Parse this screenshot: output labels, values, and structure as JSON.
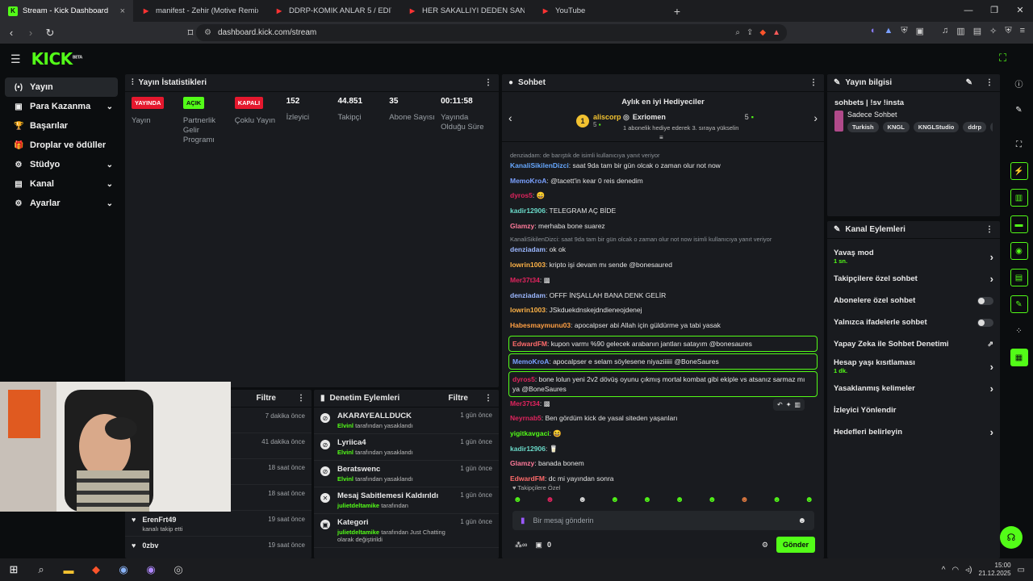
{
  "browser": {
    "tabs": [
      {
        "title": "Stream - Kick Dashboard",
        "icon": "K",
        "color": "#53fc18",
        "active": true
      },
      {
        "title": "manifest - Zehir (Motive Remix) |",
        "icon": "▶",
        "color": "#ff3333"
      },
      {
        "title": "DDRP-KOMIK ANLAR 5 / EDITLI - You",
        "icon": "▶",
        "color": "#ff3333"
      },
      {
        "title": "HER SAKALLIYI DEDEN SANMA | SSri",
        "icon": "▶",
        "color": "#ff3333"
      },
      {
        "title": "YouTube",
        "icon": "▶",
        "color": "#ff3333"
      }
    ],
    "url": "dashboard.kick.com/stream",
    "new_tab": "+"
  },
  "app": {
    "logo": "KICK",
    "logo_sup": "BETA"
  },
  "sidebar": {
    "items": [
      {
        "label": "Yayın",
        "icon": "(•)",
        "active": true
      },
      {
        "label": "Para Kazanma",
        "icon": "▣",
        "chev": "⌄"
      },
      {
        "label": "Başarılar",
        "icon": "🏆"
      },
      {
        "label": "Droplar ve ödüller",
        "icon": "🎁"
      },
      {
        "label": "Stüdyo",
        "icon": "⚙",
        "chev": "⌄"
      },
      {
        "label": "Kanal",
        "icon": "▤",
        "chev": "⌄"
      },
      {
        "label": "Ayarlar",
        "icon": "⚙",
        "chev": "⌄"
      }
    ]
  },
  "stats": {
    "title": "Yayın İstatistikleri",
    "items": [
      {
        "badge": "YAYINDA",
        "badge_bg": "#e5182e",
        "badge_fg": "#fff",
        "label": "Yayın"
      },
      {
        "badge": "AÇIK",
        "badge_bg": "#53fc18",
        "badge_fg": "#0b0d0f",
        "label": "Partnerlik Gelir Programı"
      },
      {
        "badge": "KAPALI",
        "badge_bg": "#e5182e",
        "badge_fg": "#fff",
        "label": "Çoklu Yayın"
      },
      {
        "value": "152",
        "label": "İzleyici"
      },
      {
        "value": "44.851",
        "label": "Takipçi"
      },
      {
        "value": "35",
        "label": "Abone Sayısı"
      },
      {
        "value": "00:11:58",
        "label": "Yayında Olduğu Süre"
      }
    ]
  },
  "history": {
    "filter": "Filtre",
    "rows": [
      {
        "name": "",
        "sub": "",
        "time": "7 dakika önce"
      },
      {
        "name": "",
        "sub": "",
        "time": "41 dakika önce"
      },
      {
        "name": "",
        "sub": "",
        "time": "18 saat önce"
      },
      {
        "name": "",
        "sub": "",
        "time": "18 saat önce"
      },
      {
        "name": "ErenFrt49",
        "sub": "kanalı takip etti",
        "time": "19 saat önce"
      },
      {
        "name": "0zbv",
        "sub": "",
        "time": "19 saat önce"
      }
    ]
  },
  "moderation": {
    "title": "Denetim Eylemleri",
    "filter": "Filtre",
    "rows": [
      {
        "title": "AKARAYEALLDUCK",
        "by": "Elvinl",
        "suffix": " tarafından yasaklandı",
        "time": "1 gün önce",
        "icon": "⊘"
      },
      {
        "title": "Lyriica4",
        "by": "Elvinl",
        "suffix": " tarafından yasaklandı",
        "time": "1 gün önce",
        "icon": "⊘"
      },
      {
        "title": "Beratswenc",
        "by": "Elvinl",
        "suffix": " tarafından yasaklandı",
        "time": "1 gün önce",
        "icon": "⊘"
      },
      {
        "title": "Mesaj Sabitlemesi Kaldırıldı",
        "by": "julietdeltamike",
        "suffix": " tarafından",
        "time": "1 gün önce",
        "icon": "✕"
      },
      {
        "title": "Kategori",
        "by": "julietdeltamike",
        "suffix": " tarafından Just Chatting olarak değiştirildi",
        "time": "1 gün önce",
        "icon": "▣"
      }
    ]
  },
  "chat": {
    "title": "Sohbet",
    "gifters_title": "Aylık en iyi Hediyeciler",
    "gifter1": {
      "rank": "1",
      "name": "aliscorp",
      "count": "5"
    },
    "gifter2": {
      "name": "Exriomen",
      "count": "5"
    },
    "gift_hint": "1 abonelik hediye ederek 3. sıraya yükselin",
    "messages": [
      {
        "reply": "denziadam: de barıştık de isimli kullanıcıya yanıt veriyor"
      },
      {
        "user": "KanaliSikilenDizci",
        "color": "#66a8ff",
        "text": "saat 9da tam bir gün olcak o zaman olur not now"
      },
      {
        "user": "MemoKroA",
        "color": "#7aa0ff",
        "text": "@tacett'in kear 0 reis denedim"
      },
      {
        "user": "dyros5",
        "color": "#e0245e",
        "text": "😄"
      },
      {
        "user": "kadir12906",
        "color": "#6ad9c8",
        "text": "TELEGRAM AÇ BİDE"
      },
      {
        "user": "Glamzy",
        "color": "#ff7a9a",
        "text": "merhaba bone suarez"
      },
      {
        "reply": "KanaliSikilenDizci: saat 9da tam bir gün olcak o zaman olur not now isimli kullanıcıya yanıt veriyor"
      },
      {
        "user": "denziadam",
        "color": "#9bb7ff",
        "text": "ok ok"
      },
      {
        "user": "lowrin1003",
        "color": "#ffb347",
        "text": "kripto işi devam mı sende @bonesaured"
      },
      {
        "user": "Mer37t34",
        "color": "#e0245e",
        "text": "▩"
      },
      {
        "user": "denziadam",
        "color": "#9bb7ff",
        "text": "OFFF İNŞALLAH BANA DENK GELİR"
      },
      {
        "user": "lowrin1003",
        "color": "#ffb347",
        "text": "JSkduekdnskejdndieneojdenej"
      },
      {
        "user": "Habesmaymunu03",
        "color": "#ff9f43",
        "text": "apocalpser abi Allah için güldürme ya tabi yasak"
      },
      {
        "user": "EdwardFM",
        "color": "#ff6b6b",
        "text": "kupon varmı %90 gelecek arabanın jantları satayım @bonesaures",
        "hl": true
      },
      {
        "user": "MemoKroA",
        "color": "#7aa0ff",
        "text": "apocalpser e selam söylesene niyaziiiiii @BoneSaures",
        "hl": true
      },
      {
        "user": "dyros5",
        "color": "#e0245e",
        "text": "bone lolun yeni 2v2 dövüş oyunu çıkmış mortal kombat gibi ekiple vs atsanız sarmaz mı ya @BoneSaures",
        "hl": true
      },
      {
        "user": "Mer37t34",
        "color": "#e0245e",
        "text": "▩"
      },
      {
        "user": "Neyrnab5",
        "color": "#e0245e",
        "text": "Ben gördüm kick de yasal siteden yaşanları"
      },
      {
        "user": "yigitkavgaci",
        "color": "#53fc18",
        "text": "😆"
      },
      {
        "user": "kadir12906",
        "color": "#6ad9c8",
        "text": "🥛"
      },
      {
        "user": "Glamzy",
        "color": "#ff7a9a",
        "text": "banada bonem"
      },
      {
        "user": "EdwardFM",
        "color": "#ff6b6b",
        "text": "dc mi yayından sonra"
      }
    ],
    "followers_emotes": "Takipçilere Özel",
    "placeholder": "Bir mesaj gönderin",
    "send": "Gönder",
    "viewers_count": "0"
  },
  "stream_info": {
    "title": "Yayın bilgisi",
    "stream_title": "sohbets | !sv !insta",
    "category": "Sadece Sohbet",
    "tags": [
      "Turkish",
      "KNGL",
      "KNGLStudio",
      "ddrp",
      "g"
    ]
  },
  "channel_actions": {
    "title": "Kanal Eylemleri",
    "items": [
      {
        "label": "Yavaş mod",
        "sub": "1 sn.",
        "type": "chev"
      },
      {
        "label": "Takipçilere özel sohbet",
        "type": "chev"
      },
      {
        "label": "Abonelere özel sohbet",
        "type": "toggle"
      },
      {
        "label": "Yalnızca ifadelerle sohbet",
        "type": "toggle"
      },
      {
        "label": "Yapay Zeka ile Sohbet Denetimi",
        "type": "ext"
      },
      {
        "label": "Hesap yaşı kısıtlaması",
        "sub": "1 dk.",
        "type": "chev"
      },
      {
        "label": "Yasaklanmış kelimeler",
        "type": "chev"
      },
      {
        "label": "İzleyici Yönlendir",
        "type": "none"
      },
      {
        "label": "Hedefleri belirleyin",
        "type": "chev"
      }
    ]
  },
  "taskbar": {
    "time": "15:00",
    "date": "21.12.2025"
  }
}
